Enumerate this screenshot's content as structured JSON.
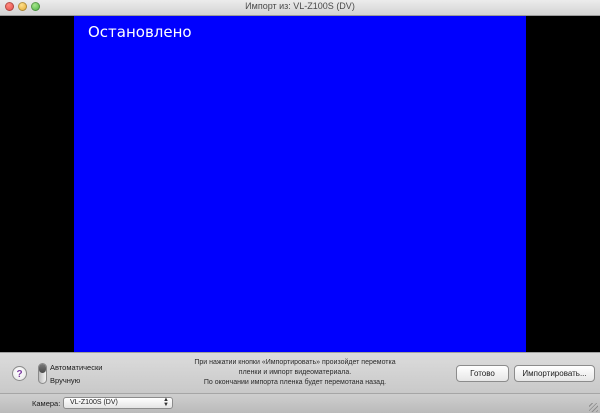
{
  "window": {
    "title": "Импорт из: VL-Z100S (DV)"
  },
  "video": {
    "status": "Остановлено",
    "screen_color": "#0000fe"
  },
  "controls": {
    "help_label": "?",
    "mode_auto": "Автоматически",
    "mode_manual": "Вручную",
    "mode_selected": "Автоматически",
    "info_line1": "При нажатии кнопки «Импортировать» произойдет перемотка",
    "info_line2": "пленки и импорт видеоматериала.",
    "info_line3": "По окончании импорта пленка будет перемотана назад.",
    "done_button": "Готово",
    "import_button": "Импортировать..."
  },
  "bottom_bar": {
    "camera_label": "Камера:",
    "camera_value": "VL-Z100S (DV)"
  },
  "icons": {
    "close": "close-icon",
    "minimize": "minimize-icon",
    "zoom": "zoom-icon",
    "help": "help-icon",
    "select_arrows": "chevron-updown-icon",
    "resize": "resize-grip-icon"
  }
}
